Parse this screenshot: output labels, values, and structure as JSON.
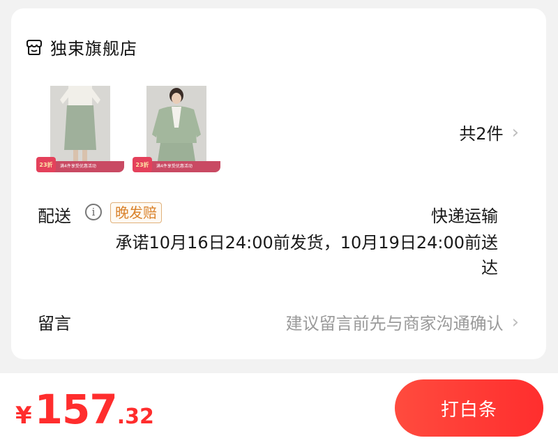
{
  "store": {
    "name": "独束旗舰店",
    "icon": "shop-icon"
  },
  "items": [
    {
      "badge": "23折",
      "promo": "满4件享受优惠活动",
      "icon": "product-image"
    },
    {
      "badge": "23折",
      "promo": "满4件享受优惠活动",
      "icon": "product-image"
    }
  ],
  "summary": {
    "count_text": "共2件"
  },
  "shipping": {
    "label": "配送",
    "late_badge": "晚发赔",
    "method": "快递运输",
    "promise": "承诺10月16日24:00前发货，10月19日24:00前送达"
  },
  "message": {
    "label": "留言",
    "hint": "建议留言前先与商家沟通确认"
  },
  "footer": {
    "currency": "¥",
    "price_int": "157",
    "price_dec": ".32",
    "pay_label": "打白条"
  },
  "colors": {
    "accent": "#ff2d2d",
    "badge_orange": "#d9822b",
    "card_bg": "#ffffff",
    "page_bg": "#f2f2f2"
  }
}
